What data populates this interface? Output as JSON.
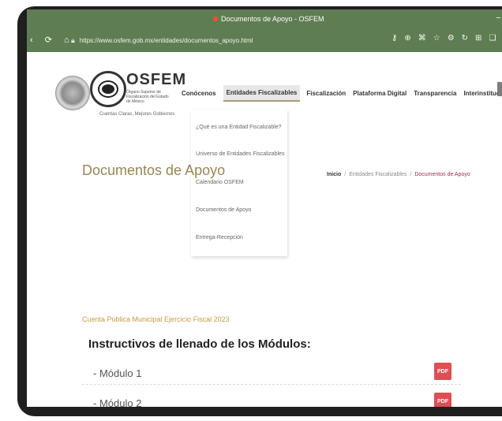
{
  "window": {
    "title": "Documentos de Apoyo - OSFEM",
    "controls": "–"
  },
  "browser": {
    "url": "https://www.osfem.gob.mx/entidades/documentos_apoyo.html",
    "nav": "‹ ⟳ ⌂"
  },
  "header": {
    "brand": "OSFEM",
    "brand_sub": "Órgano Superior de Fiscalización del Estado de México",
    "tagline": "Cuentas Claras, Mejores Gobiernos",
    "menu": [
      "Conócenos",
      "Entidades Fiscalizables",
      "Fiscalización",
      "Plataforma Digital",
      "Transparencia",
      "Interinstitucionalidad"
    ],
    "search_label": "Q"
  },
  "dropdown": [
    "¿Qué es una Entidad Fiscalizable?",
    "Universo de Entidades Fiscalizables",
    "Calendario OSFEM",
    "Documentos de Apoyo",
    "Entrega-Recepción"
  ],
  "page": {
    "title": "Documentos de Apoyo",
    "breadcrumb": {
      "home": "Inicio",
      "mid": "Entidades Fiscalizables",
      "current": "Documentos de Apoyo",
      "sep": "/"
    }
  },
  "content": {
    "fiscal_year": "Cuenta Pública Municipal Ejercicio Fiscal 2023",
    "heading": "Instructivos de llenado de los Módulos:",
    "modules": [
      {
        "label": "- Módulo 1",
        "pdf": "PDF"
      },
      {
        "label": "- Módulo 2",
        "pdf": "PDF"
      }
    ]
  },
  "colors": {
    "chrome": "#5f7d53",
    "accent": "#9a8456",
    "pdf": "#dd4f53"
  }
}
